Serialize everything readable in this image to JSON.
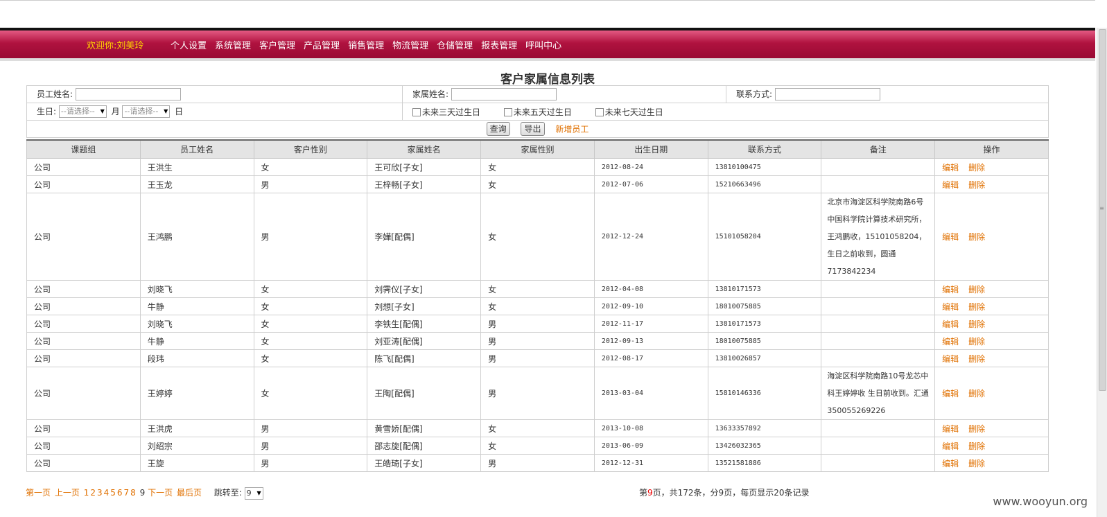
{
  "header": {
    "welcome_label": "欢迎你:",
    "user_name": "刘美玲",
    "menu": [
      "个人设置",
      "系统管理",
      "客户管理",
      "产品管理",
      "销售管理",
      "物流管理",
      "仓储管理",
      "报表管理",
      "呼叫中心"
    ]
  },
  "page_title": "客户家属信息列表",
  "filters": {
    "employee_name_label": "员工姓名:",
    "family_name_label": "家属姓名:",
    "contact_label": "联系方式:",
    "birthday_label": "生日:",
    "month_placeholder": "--请选择--",
    "month_label": "月",
    "day_placeholder": "--请选择--",
    "day_label": "日",
    "checkbox_3days": "未来三天过生日",
    "checkbox_5days": "未来五天过生日",
    "checkbox_7days": "未来七天过生日",
    "query_button": "查询",
    "export_button": "导出",
    "add_link": "新增员工"
  },
  "table": {
    "columns": [
      "课题组",
      "员工姓名",
      "客户性别",
      "家属姓名",
      "家属性别",
      "出生日期",
      "联系方式",
      "备注",
      "操作"
    ],
    "edit_label": "编辑",
    "delete_label": "删除",
    "rows": [
      [
        "公司",
        "王洪生",
        "女",
        "王可欣[子女]",
        "女",
        "2012-08-24",
        "13810100475",
        ""
      ],
      [
        "公司",
        "王玉龙",
        "男",
        "王梓畅[子女]",
        "女",
        "2012-07-06",
        "15210663496",
        ""
      ],
      [
        "公司",
        "王鸿鹏",
        "男",
        "李嬅[配偶]",
        "女",
        "2012-12-24",
        "15101058204",
        "北京市海淀区科学院南路6号中国科学院计算技术研究所，王鸿鹏收，15101058204，生日之前收到，圆通7173842234"
      ],
      [
        "公司",
        "刘晓飞",
        "女",
        "刘霁仪[子女]",
        "女",
        "2012-04-08",
        "13810171573",
        ""
      ],
      [
        "公司",
        "牛静",
        "女",
        "刘想[子女]",
        "女",
        "2012-09-10",
        "18010075885",
        ""
      ],
      [
        "公司",
        "刘晓飞",
        "女",
        "李铁生[配偶]",
        "男",
        "2012-11-17",
        "13810171573",
        ""
      ],
      [
        "公司",
        "牛静",
        "女",
        "刘亚涛[配偶]",
        "男",
        "2012-09-13",
        "18010075885",
        ""
      ],
      [
        "公司",
        "段玮",
        "女",
        "陈飞[配偶]",
        "男",
        "2012-08-17",
        "13810026857",
        ""
      ],
      [
        "公司",
        "王婷婷",
        "女",
        "王陶[配偶]",
        "男",
        "2013-03-04",
        "15810146336",
        "海淀区科学院南路10号龙芯中科王婷婷收 生日前收到。汇通350055269226"
      ],
      [
        "公司",
        "王洪虎",
        "男",
        "黄雪娇[配偶]",
        "女",
        "2013-10-08",
        "13633357892",
        ""
      ],
      [
        "公司",
        "刘绍宗",
        "男",
        "邵志旋[配偶]",
        "女",
        "2013-06-09",
        "13426032365",
        ""
      ],
      [
        "公司",
        "王旋",
        "男",
        "王皓琦[子女]",
        "男",
        "2012-12-31",
        "13521581886",
        ""
      ]
    ]
  },
  "pager": {
    "first": "第一页",
    "prev": "上一页",
    "pages": [
      "1",
      "2",
      "3",
      "4",
      "5",
      "6",
      "7",
      "8"
    ],
    "current": "9",
    "next": "下一页",
    "last": "最后页",
    "jump_label": "跳转至:",
    "jump_value": "9",
    "info_prefix": "第",
    "info_page": "9",
    "info_suffix": "页，共172条，分9页，每页显示20条记录"
  },
  "watermark": "www.wooyun.org"
}
